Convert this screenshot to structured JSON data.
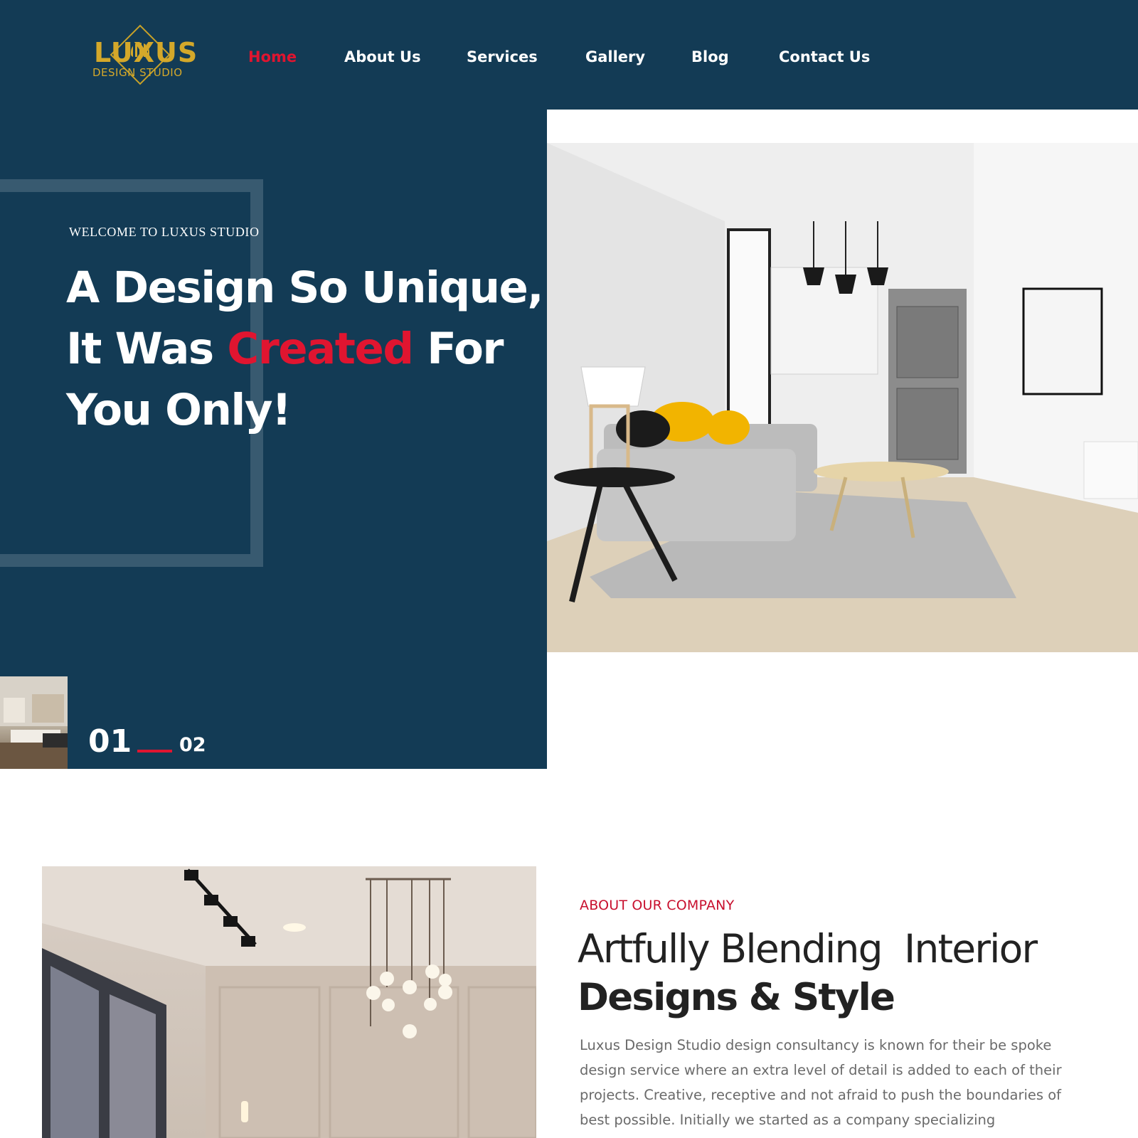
{
  "colors": {
    "navy": "#133b55",
    "accent_red": "#e01530",
    "gold": "#d4a82a",
    "text_dark": "#222222",
    "text_muted": "#6a6a6a"
  },
  "logo": {
    "line1": "LUXUS",
    "line2": "DESIGN STUDIO"
  },
  "nav": {
    "items": [
      {
        "label": "Home",
        "active": true
      },
      {
        "label": "About Us",
        "active": false
      },
      {
        "label": "Services",
        "active": false
      },
      {
        "label": "Gallery",
        "active": false
      },
      {
        "label": "Blog",
        "active": false
      },
      {
        "label": "Contact Us",
        "active": false
      }
    ]
  },
  "hero": {
    "welcome": "WELCOME TO LUXUS STUDIO",
    "title_line1": "A Design So Unique,",
    "title_line2_pre": "It Was ",
    "title_line2_accent": "Created",
    "title_line2_post": " For",
    "title_line3": "You Only!",
    "slide_current": "01",
    "slide_next": "02"
  },
  "about": {
    "eyebrow": "ABOUT OUR COMPANY",
    "title_line1": "Artfully Blending  Interior",
    "title_line2": "Designs & Style",
    "body_lines": [
      "Luxus Design Studio design consultancy is known for their be spoke",
      "design service where an extra level of detail is added to each of their",
      "projects. Creative, receptive and not afraid to push the boundaries of",
      "best possible. Initially we started as a company specializing"
    ]
  }
}
